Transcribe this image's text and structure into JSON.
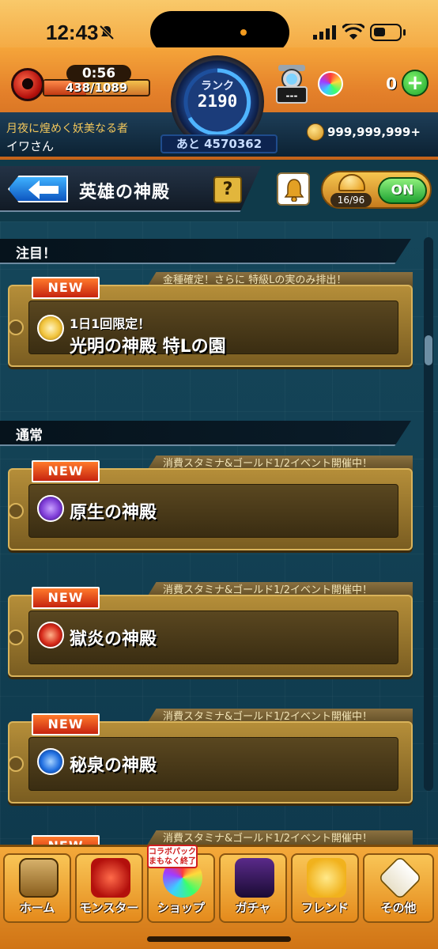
{
  "status_bar": {
    "time": "12:43"
  },
  "hud": {
    "stamina_timer": "0:56",
    "stamina": "438/1089",
    "stamina_fill": 0.4,
    "rank_label": "ランク",
    "rank_value": "2190",
    "exp_remaining": "あと 4570362",
    "orb_machine_label": "---",
    "orb_count": "0",
    "player_title": "月夜に煌めく妖美なる者",
    "player_name": "イワさん",
    "gold": "999,999,999+"
  },
  "header": {
    "title": "英雄の神殿",
    "help_label": "?",
    "ball_count": "16/96",
    "toggle_label": "ON"
  },
  "sections": [
    {
      "label": "注目！"
    },
    {
      "label": "通常"
    }
  ],
  "cards": [
    {
      "badge": "NEW",
      "ticker": "金種確定！さらに  特級Lの実のみ排出！",
      "subtitle": "1日1回限定！",
      "title": "光明の神殿 特Lの園",
      "element": "light-icon",
      "color": "#f1c33b"
    },
    {
      "badge": "NEW",
      "ticker": "消費スタミナ&ゴールド1/2イベント開催中！",
      "title": "原生の神殿",
      "element": "dark-icon",
      "color": "#7d3bd6"
    },
    {
      "badge": "NEW",
      "ticker": "消費スタミナ&ゴールド1/2イベント開催中！",
      "title": "獄炎の神殿",
      "element": "fire-icon",
      "color": "#d62a1a"
    },
    {
      "badge": "NEW",
      "ticker": "消費スタミナ&ゴールド1/2イベント開催中！",
      "title": "秘泉の神殿",
      "element": "water-icon",
      "color": "#1f6ee0"
    },
    {
      "badge": "NEW",
      "ticker": "消費スタミナ&ゴールド1/2イベント開催中！",
      "title": "",
      "element": "",
      "color": ""
    }
  ],
  "bottom_nav": {
    "collab_tag": "コラボパック まもなく終了",
    "items": [
      {
        "label": "ホーム"
      },
      {
        "label": "モンスター"
      },
      {
        "label": "ショップ"
      },
      {
        "label": "ガチャ"
      },
      {
        "label": "フレンド"
      },
      {
        "label": "その他"
      }
    ]
  }
}
